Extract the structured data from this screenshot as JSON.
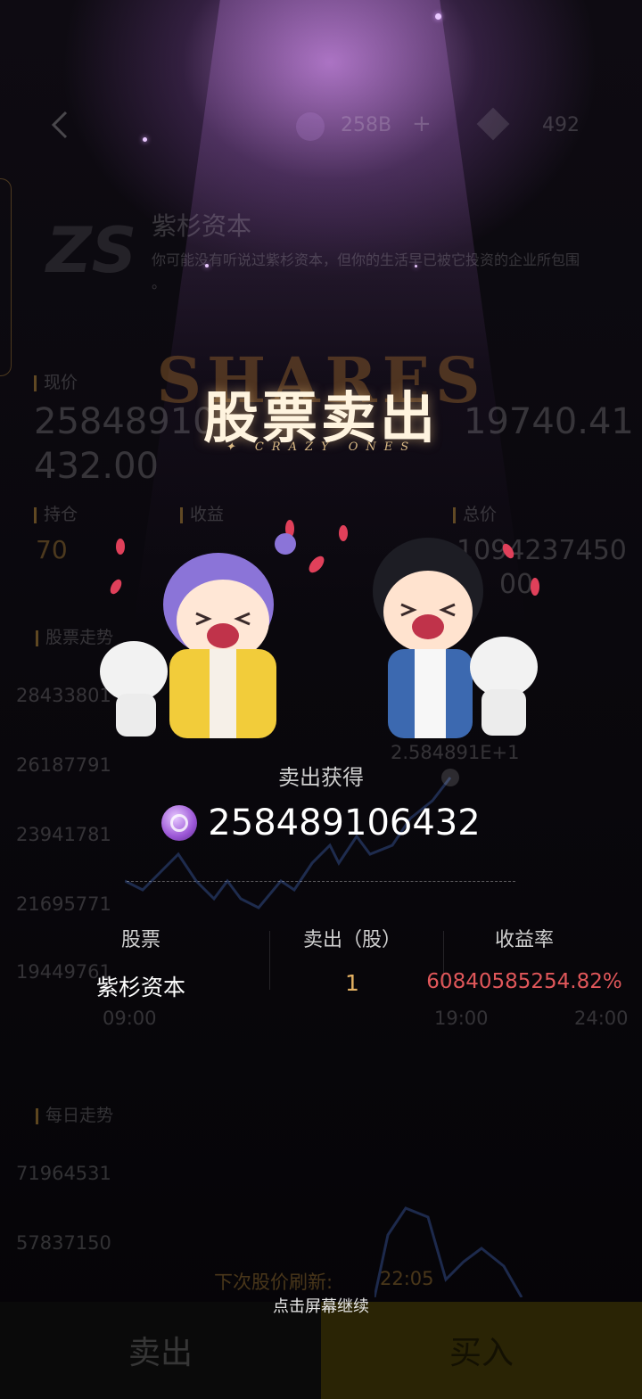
{
  "header": {
    "coins": "258B",
    "plus": "+",
    "gems": "492"
  },
  "company": {
    "logo": "ZS",
    "name": "紫杉资本",
    "description": "你可能没有听说过紫杉资本，但你的生活早已被它投资的企业所包围",
    "description_tail": "。"
  },
  "stats": {
    "price_label": "现价",
    "price_value": "258489106432.00",
    "price_value_line1": "25848910",
    "price_value_line2": "432.00",
    "cost_value": "19740.41",
    "holding_label": "持仓",
    "holding_value": "70",
    "profit_label": "收益",
    "total_label": "总价",
    "total_value_partial": "1094237450",
    "total_value_tail": "00"
  },
  "trend": {
    "title": "股票走势",
    "y_labels": [
      "28433801",
      "26187791",
      "23941781",
      "21695771",
      "19449761"
    ],
    "x_labels": [
      "09:00",
      "19:00",
      "24:00"
    ],
    "marker_label": "2.584891E+1"
  },
  "daily": {
    "title": "每日走势",
    "y_labels": [
      "71964531",
      "57837150"
    ]
  },
  "refresh": {
    "label": "下次股价刷新:",
    "time": "22:05"
  },
  "bottom": {
    "sell": "卖出",
    "buy": "买入"
  },
  "popup": {
    "watermark": "SHARES",
    "title": "股票卖出",
    "subtitle": "CRAZY ONES",
    "gain_label": "卖出获得",
    "gain_amount": "258489106432",
    "table": {
      "headers": [
        "股票",
        "卖出（股）",
        "收益率"
      ],
      "row": {
        "stock": "紫杉资本",
        "sold": "1",
        "rate": "60840585254.82%"
      }
    },
    "continue_hint": "点击屏幕继续"
  },
  "colors": {
    "gold": "#e3b062",
    "red": "#e0575a",
    "purple_glow": "#c88be6"
  },
  "icons": {
    "back": "chevron-left-icon",
    "coin": "purple-coin-icon",
    "gem": "diamond-icon"
  }
}
